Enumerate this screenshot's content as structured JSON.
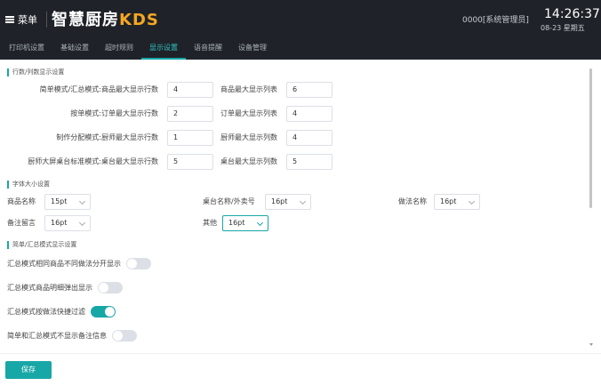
{
  "header": {
    "menu_label": "菜单",
    "brand_main": "智慧厨房",
    "brand_suffix": "KDS",
    "user": "0000[系统管理员]",
    "time": "14:26:37",
    "date": "08-23 星期五"
  },
  "tabs": [
    {
      "label": "打印机设置"
    },
    {
      "label": "基础设置"
    },
    {
      "label": "超时规则"
    },
    {
      "label": "显示设置"
    },
    {
      "label": "语音提醒"
    },
    {
      "label": "设备管理"
    }
  ],
  "active_tab": 3,
  "section_rows": {
    "title": "行数/列数显示设置",
    "rows": [
      {
        "mode": "简单模式/汇总模式:",
        "a_label": "商品最大显示行数",
        "a_value": "4",
        "b_label": "商品最大显示列表",
        "b_value": "6"
      },
      {
        "mode": "按单模式:",
        "a_label": "订单最大显示行数",
        "a_value": "2",
        "b_label": "订单最大显示列表",
        "b_value": "4"
      },
      {
        "mode": "制作分配模式:",
        "a_label": "厨师最大显示行数",
        "a_value": "1",
        "b_label": "厨师最大显示列数",
        "b_value": "4"
      },
      {
        "mode": "厨师大屏桌台标准模式:",
        "a_label": "桌台最大显示行数",
        "a_value": "5",
        "b_label": "桌台最大显示列数",
        "b_value": "5"
      }
    ]
  },
  "section_font": {
    "title": "字体大小设置",
    "product_name": {
      "label": "商品名称",
      "value": "15pt"
    },
    "table_name": {
      "label": "桌台名称/外卖号",
      "value": "16pt"
    },
    "method_name": {
      "label": "做法名称",
      "value": "16pt"
    },
    "remark": {
      "label": "备注留言",
      "value": "16pt"
    },
    "other": {
      "label": "其他",
      "value": "16pt"
    }
  },
  "section_summary": {
    "title": "简单/汇总模式显示设置",
    "switches": [
      {
        "label": "汇总模式相同商品不同做法分开显示",
        "on": false
      },
      {
        "label": "汇总模式商品明细弹出显示",
        "on": false
      },
      {
        "label": "汇总模式按做法快捷过滤",
        "on": true
      },
      {
        "label": "简单和汇总模式不显示备注信息",
        "on": false
      }
    ]
  },
  "footer": {
    "save_label": "保存"
  },
  "colors": {
    "accent": "#18a7a7",
    "header_bg": "#1f2329",
    "brand_suffix": "#f5a623"
  }
}
